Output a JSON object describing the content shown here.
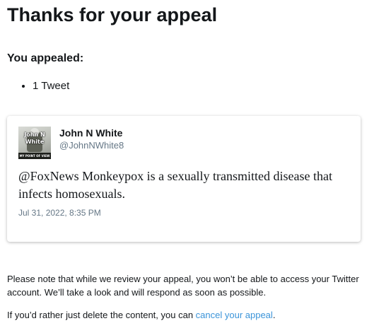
{
  "page": {
    "title": "Thanks for your appeal",
    "appealed_label": "You appealed:",
    "appealed_items": [
      "1 Tweet"
    ]
  },
  "tweet": {
    "author_name": "John N White",
    "author_handle": "@JohnNWhite8",
    "avatar_text_line1": "John N",
    "avatar_text_line2": "White",
    "avatar_strip_text": "MY POINT OF VIEW",
    "text": "@FoxNews Monkeypox is a sexually transmitted disease that infects homosexuals.",
    "timestamp": "Jul 31, 2022, 8:35 PM"
  },
  "notice": {
    "text": "Please note that while we review your appeal, you won’t be able to access your Twitter account. We’ll take a look and will respond as soon as possible.",
    "cancel_prefix": "If you’d rather just delete the content, you can ",
    "cancel_link": "cancel your appeal",
    "cancel_suffix": "."
  },
  "colors": {
    "text_primary": "#14171a",
    "text_secondary": "#657786",
    "link": "#3b94d9"
  }
}
